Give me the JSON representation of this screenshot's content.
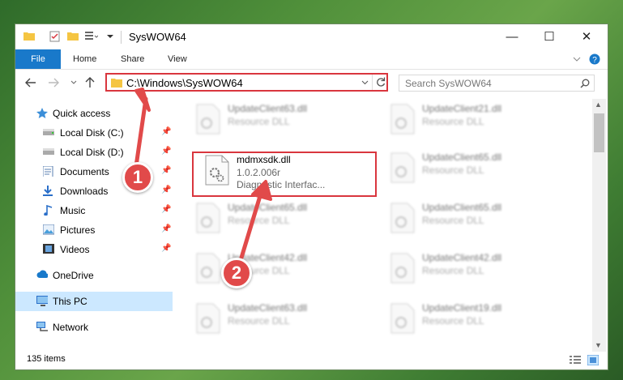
{
  "window": {
    "title": "SysWOW64",
    "controls": {
      "minimize": "—",
      "maximize": "☐",
      "close": "✕"
    }
  },
  "ribbon": {
    "tabs": [
      "File",
      "Home",
      "Share",
      "View"
    ]
  },
  "nav": {
    "address": "C:\\Windows\\SysWOW64",
    "search_placeholder": "Search SysWOW64"
  },
  "sidebar": {
    "items": [
      {
        "label": "Quick access",
        "icon": "star-icon"
      },
      {
        "label": "Local Disk (C:)",
        "icon": "drive-icon",
        "pinned": true
      },
      {
        "label": "Local Disk (D:)",
        "icon": "drive-icon",
        "pinned": true
      },
      {
        "label": "Documents",
        "icon": "documents-icon",
        "pinned": true
      },
      {
        "label": "Downloads",
        "icon": "downloads-icon",
        "pinned": true
      },
      {
        "label": "Music",
        "icon": "music-icon",
        "pinned": true
      },
      {
        "label": "Pictures",
        "icon": "pictures-icon",
        "pinned": true
      },
      {
        "label": "Videos",
        "icon": "videos-icon",
        "pinned": true
      },
      {
        "label": "OneDrive",
        "icon": "cloud-icon"
      },
      {
        "label": "This PC",
        "icon": "pc-icon",
        "selected": true
      },
      {
        "label": "Network",
        "icon": "network-icon"
      }
    ]
  },
  "files": {
    "left": [
      {
        "name": "UpdateClient63.dll",
        "line2": "Resource DLL"
      },
      {
        "name": "mdmxsdk.dll",
        "line2": "1.0.2.006r",
        "line3": "Diagnostic Interfac..."
      },
      {
        "name": "UpdateClient65.dll",
        "line2": "Resource DLL"
      },
      {
        "name": "UpdateClient42.dll",
        "line2": "Resource DLL"
      },
      {
        "name": "UpdateClient63.dll",
        "line2": "Resource DLL"
      }
    ],
    "right": [
      {
        "name": "UpdateClient21.dll",
        "line2": "Resource DLL"
      },
      {
        "name": "UpdateClient65.dll",
        "line2": "Resource DLL"
      },
      {
        "name": "UpdateClient65.dll",
        "line2": "Resource DLL"
      },
      {
        "name": "UpdateClient42.dll",
        "line2": "Resource DLL"
      },
      {
        "name": "UpdateClient19.dll",
        "line2": "Resource DLL"
      }
    ]
  },
  "status": {
    "item_count": "135 items"
  },
  "callouts": {
    "one": "1",
    "two": "2"
  },
  "colors": {
    "accent": "#1979ca",
    "highlight": "#d9363e",
    "selected": "#cce8ff"
  }
}
